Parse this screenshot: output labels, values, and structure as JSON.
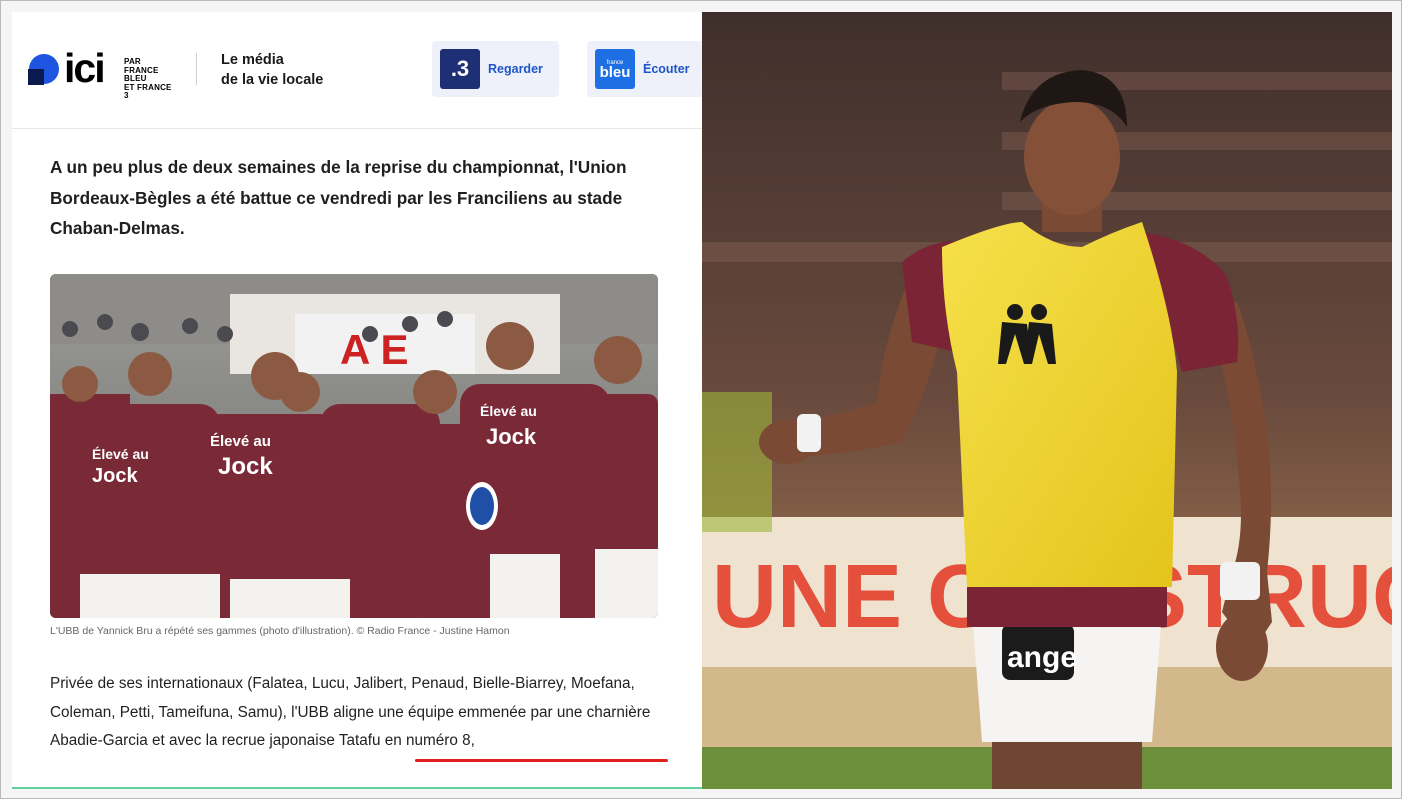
{
  "header": {
    "logo_word": "ici",
    "logo_sub_lines": [
      "PAR",
      "FRANCE BLEU",
      "ET FRANCE 3"
    ],
    "tagline_line1": "Le média",
    "tagline_line2": "de la vie locale",
    "watch_button": {
      "icon_text": ".3",
      "label": "Regarder",
      "icon": "france3-icon"
    },
    "listen_button": {
      "icon_text": "bleu",
      "icon_small": "france",
      "label": "Écouter",
      "icon": "france-bleu-icon"
    }
  },
  "article": {
    "lead": "A un peu plus de deux semaines de la reprise du championnat, l'Union Bordeaux-Bègles a été battue ce vendredi par les Franciliens au stade Chaban-Delmas.",
    "photo_caption": "L'UBB de Yannick Bru a répété ses gammes (photo d'illustration). © Radio France - Justine Hamon",
    "body": "Privée de ses internationaux (Falatea, Lucu, Jalibert, Penaud, Bielle-Biarrey, Moefana, Coleman, Petti, Tameifuna, Samu), l'UBB aligne une équipe emmenée par une charnière Abadie-Garcia et avec la recrue japonaise Tatafu en numéro 8,",
    "highlight_color": "#e21f1f"
  },
  "photo_texts": {
    "jersey_1": "Élevé au",
    "jersey_2": "Jock",
    "sponsor": "ange",
    "brand": "Kappa",
    "stand": "UNE CONSTRUCTI"
  },
  "colors": {
    "accent_blue": "#1d55c9",
    "button_bg": "#eef1f9",
    "jersey": "#7a2a36",
    "bib": "#f0d52a"
  }
}
